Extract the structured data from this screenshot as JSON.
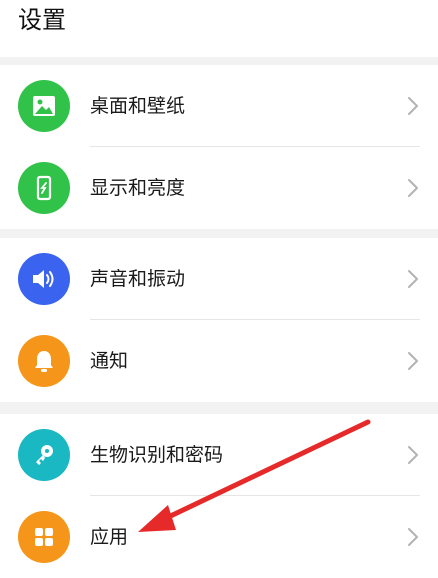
{
  "header": {
    "title": "设置"
  },
  "groups": [
    {
      "items": [
        {
          "label": "桌面和壁纸",
          "icon": "wallpaper-icon",
          "color": "#31c24a"
        },
        {
          "label": "显示和亮度",
          "icon": "display-icon",
          "color": "#31c24a"
        }
      ]
    },
    {
      "items": [
        {
          "label": "声音和振动",
          "icon": "sound-icon",
          "color": "#3a63f0"
        },
        {
          "label": "通知",
          "icon": "notification-bell-icon",
          "color": "#f5961b"
        }
      ]
    },
    {
      "items": [
        {
          "label": "生物识别和密码",
          "icon": "key-icon",
          "color": "#19b8c2"
        },
        {
          "label": "应用",
          "icon": "apps-grid-icon",
          "color": "#f5961b"
        }
      ]
    }
  ],
  "annotation": {
    "arrow_color": "#e62a2a"
  }
}
